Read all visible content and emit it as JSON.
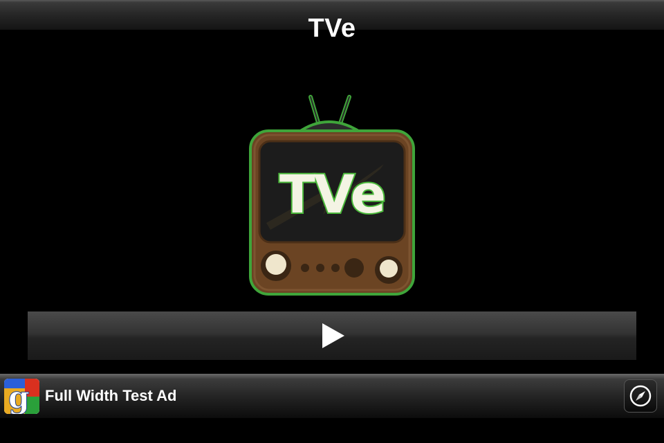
{
  "navbar": {
    "title": "TVe"
  },
  "logo": {
    "text": "TVe",
    "colors": {
      "cabinet": "#6b4423",
      "outline": "#3fa53a",
      "screen": "#1a1a1a",
      "knob": "#efe6cc"
    }
  },
  "player": {
    "play_icon": "play-icon"
  },
  "ad": {
    "text": "Full Width Test Ad",
    "logo_icon": "google-logo-icon",
    "action_icon": "compass-icon"
  }
}
